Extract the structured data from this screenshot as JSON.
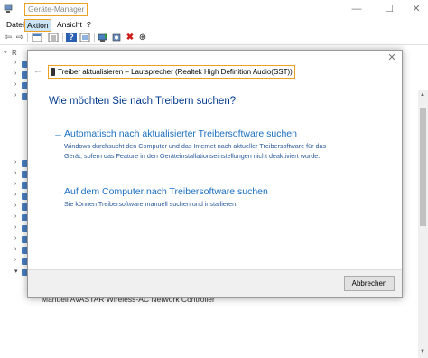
{
  "window": {
    "title": "Geräte-Manager",
    "minimize_glyph": "—",
    "maximize_glyph": "☐",
    "close_glyph": "✕"
  },
  "menu": [
    {
      "label": "Datei",
      "active": false
    },
    {
      "label": "Aktion",
      "active": true
    },
    {
      "label": "Ansicht",
      "active": false
    },
    {
      "label": "?",
      "active": false
    }
  ],
  "toolbar": {
    "icons": [
      "back-icon",
      "forward-icon",
      "properties-icon",
      "list-icon",
      "help-icon",
      "view-icon",
      "update-driver-icon",
      "uninstall-icon",
      "scan-hardware-icon"
    ],
    "back_glyph": "⇦",
    "forward_glyph": "⇨",
    "help_glyph": "?",
    "delete_glyph": "✖",
    "scan_glyph": "⊕"
  },
  "tree": {
    "root_label": "R",
    "bottom_device": "Manuell AVASTAR Wireless-AC Network Controller"
  },
  "dialog": {
    "back_glyph": "←",
    "close_glyph": "✕",
    "header": "Treiber aktualisieren – Lautsprecher (Realtek High Definition Audio(SST))",
    "question": "Wie möchten Sie nach Treibern suchen?",
    "option1": {
      "arrow": "→",
      "title": "Automatisch nach aktualisierter Treibersoftware suchen",
      "description": "Windows durchsucht den Computer und das Internet nach aktueller Treibersoftware für das Gerät, sofern das Feature in den Geräteinstallationseinstellungen nicht deaktiviert wurde."
    },
    "option2": {
      "arrow": "→",
      "title": "Auf dem Computer nach Treibersoftware suchen",
      "description": "Sie können Treibersoftware manuell suchen und installieren."
    },
    "cancel_label": "Abbrechen"
  },
  "colors": {
    "highlight": "#f0a020",
    "link": "#1a6fc0",
    "heading": "#003a8c"
  }
}
